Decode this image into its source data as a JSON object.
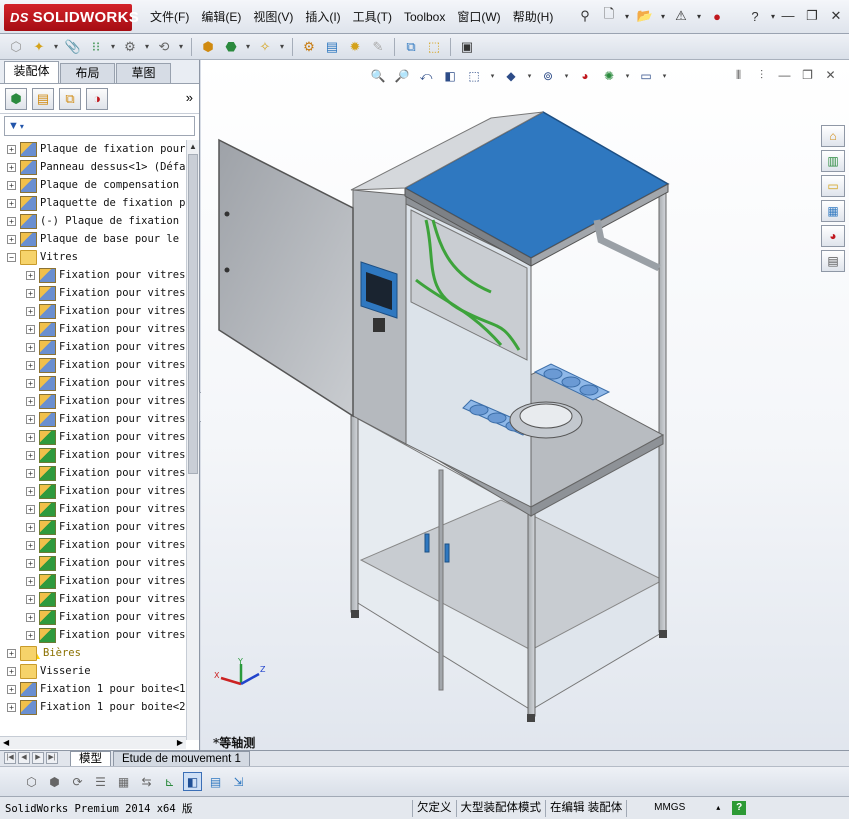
{
  "app": {
    "logo_text": "SOLIDWORKS",
    "logo_prefix": "DS"
  },
  "menu": [
    "文件(F)",
    "编辑(E)",
    "视图(V)",
    "插入(I)",
    "工具(T)",
    "Toolbox",
    "窗口(W)",
    "帮助(H)"
  ],
  "left_tabs": [
    "装配体",
    "布局",
    "草图"
  ],
  "tree": [
    {
      "label": "Plaque de fixation pour",
      "level": 0,
      "type": "part",
      "expand": "+"
    },
    {
      "label": "Panneau dessus<1> (Défa",
      "level": 0,
      "type": "part",
      "expand": "+"
    },
    {
      "label": "Plaque de compensation :",
      "level": 0,
      "type": "part",
      "expand": "+"
    },
    {
      "label": "Plaquette de fixation po",
      "level": 0,
      "type": "part",
      "expand": "+"
    },
    {
      "label": "(-) Plaque de fixation p",
      "level": 0,
      "type": "part",
      "expand": "+"
    },
    {
      "label": "Plaque de base pour le l",
      "level": 0,
      "type": "part",
      "expand": "+"
    },
    {
      "label": "Vitres",
      "level": 0,
      "type": "folder",
      "expand": "−"
    },
    {
      "label": "Fixation pour vitres",
      "level": 1,
      "type": "part",
      "expand": "+"
    },
    {
      "label": "Fixation pour vitres",
      "level": 1,
      "type": "part",
      "expand": "+"
    },
    {
      "label": "Fixation pour vitres",
      "level": 1,
      "type": "part",
      "expand": "+"
    },
    {
      "label": "Fixation pour vitres",
      "level": 1,
      "type": "part",
      "expand": "+"
    },
    {
      "label": "Fixation pour vitres",
      "level": 1,
      "type": "part",
      "expand": "+"
    },
    {
      "label": "Fixation pour vitres",
      "level": 1,
      "type": "part",
      "expand": "+"
    },
    {
      "label": "Fixation pour vitres",
      "level": 1,
      "type": "part",
      "expand": "+"
    },
    {
      "label": "Fixation pour vitres",
      "level": 1,
      "type": "part",
      "expand": "+"
    },
    {
      "label": "Fixation pour vitres",
      "level": 1,
      "type": "part",
      "expand": "+"
    },
    {
      "label": "Fixation pour vitres",
      "level": 1,
      "type": "part2",
      "expand": "+"
    },
    {
      "label": "Fixation pour vitres",
      "level": 1,
      "type": "part2",
      "expand": "+"
    },
    {
      "label": "Fixation pour vitres",
      "level": 1,
      "type": "part2",
      "expand": "+"
    },
    {
      "label": "Fixation pour vitres",
      "level": 1,
      "type": "part2",
      "expand": "+"
    },
    {
      "label": "Fixation pour vitres",
      "level": 1,
      "type": "part2",
      "expand": "+"
    },
    {
      "label": "Fixation pour vitres",
      "level": 1,
      "type": "part2",
      "expand": "+"
    },
    {
      "label": "Fixation pour vitres",
      "level": 1,
      "type": "part2",
      "expand": "+"
    },
    {
      "label": "Fixation pour vitres",
      "level": 1,
      "type": "part2",
      "expand": "+"
    },
    {
      "label": "Fixation pour vitres",
      "level": 1,
      "type": "part2",
      "expand": "+"
    },
    {
      "label": "Fixation pour vitres",
      "level": 1,
      "type": "part2",
      "expand": "+"
    },
    {
      "label": "Fixation pour vitres",
      "level": 1,
      "type": "part2",
      "expand": "+"
    },
    {
      "label": "Fixation pour vitres",
      "level": 1,
      "type": "part2",
      "expand": "+"
    },
    {
      "label": "Bières",
      "level": 0,
      "type": "folder-warn",
      "expand": "+"
    },
    {
      "label": "Visserie",
      "level": 0,
      "type": "folder",
      "expand": "+"
    },
    {
      "label": "Fixation 1 pour boite<1",
      "level": 0,
      "type": "part",
      "expand": "+"
    },
    {
      "label": "Fixation 1 pour boite<2",
      "level": 0,
      "type": "part",
      "expand": "+"
    }
  ],
  "view_name": "*等轴测",
  "triad": {
    "x": "X",
    "y": "Y",
    "z": "Z"
  },
  "bottom_tabs": [
    "模型",
    "Etude de mouvement 1"
  ],
  "status": {
    "app": "SolidWorks Premium 2014 x64 版",
    "underdefined": "欠定义",
    "large_assembly": "大型装配体模式",
    "editing": "在编辑 装配体",
    "units": "MMGS",
    "help": "?"
  },
  "colors": {
    "panel_top": "#2f78c0",
    "brand_red": "#c0181f",
    "pipe_green": "#3da33b"
  }
}
